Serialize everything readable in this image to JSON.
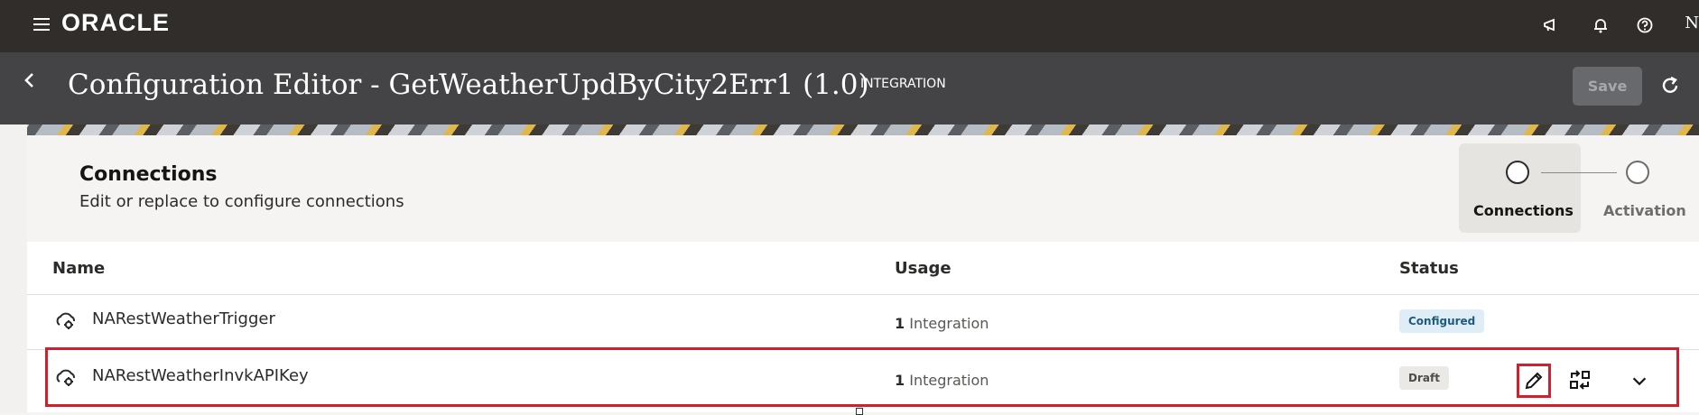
{
  "topbar": {
    "logo": "ORACLE",
    "user_initial": "N"
  },
  "header": {
    "title": "Configuration Editor - GetWeatherUpdByCity2Err1 (1.0)",
    "type": "INTEGRATION",
    "save_label": "Save"
  },
  "section": {
    "title": "Connections",
    "subtitle": "Edit or replace to configure connections"
  },
  "train": {
    "steps": [
      {
        "label": "Connections",
        "active": true
      },
      {
        "label": "Activation",
        "active": false
      }
    ]
  },
  "table": {
    "columns": [
      "Name",
      "Usage",
      "Status"
    ],
    "rows": [
      {
        "name": "NARestWeatherTrigger",
        "usage_count": "1",
        "usage_label": "Integration",
        "status": "Configured"
      },
      {
        "name": "NARestWeatherInvkAPIKey",
        "usage_count": "1",
        "usage_label": "Integration",
        "status": "Draft"
      }
    ]
  },
  "colors": {
    "topbar": "#312d2a",
    "header": "#444446",
    "highlight": "#d0202e"
  }
}
